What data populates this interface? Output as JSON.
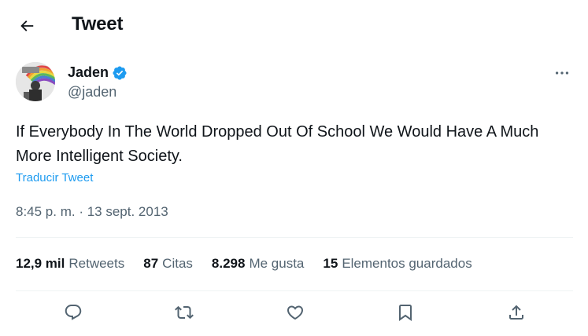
{
  "header": {
    "title": "Tweet",
    "back_icon": "arrow-left-icon"
  },
  "author": {
    "name": "Jaden",
    "handle": "@jaden",
    "verified": true,
    "verified_color": "#1d9bf0",
    "more_icon": "more-horizontal-icon"
  },
  "tweet": {
    "text": "If Everybody In The World Dropped Out Of School We Would Have A Much More Intelligent Society.",
    "translate_label": "Traducir Tweet",
    "timestamp": "8:45 p. m. · 13 sept. 2013"
  },
  "stats": [
    {
      "count": "12,9 mil",
      "label": "Retweets"
    },
    {
      "count": "87",
      "label": "Citas"
    },
    {
      "count": "8.298",
      "label": "Me gusta"
    },
    {
      "count": "15",
      "label": "Elementos guardados"
    }
  ],
  "actions": [
    {
      "name": "reply",
      "icon": "reply-icon"
    },
    {
      "name": "retweet",
      "icon": "retweet-icon"
    },
    {
      "name": "like",
      "icon": "heart-icon"
    },
    {
      "name": "bookmark",
      "icon": "bookmark-icon"
    },
    {
      "name": "share",
      "icon": "share-icon"
    }
  ],
  "colors": {
    "text": "#0f1419",
    "secondary": "#536471",
    "link": "#1d9bf0",
    "divider": "#eff3f4"
  }
}
